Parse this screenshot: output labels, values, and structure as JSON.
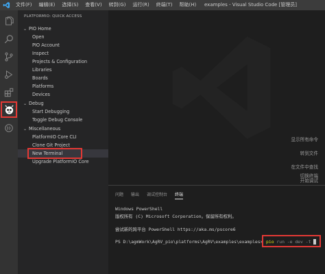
{
  "titlebar": {
    "menus": [
      "文件(F)",
      "编辑(E)",
      "选择(S)",
      "查看(V)",
      "转到(G)",
      "运行(R)",
      "终端(T)",
      "帮助(H)"
    ],
    "window_title": "examples - Visual Studio Code [管理员]"
  },
  "activity_bar": {
    "icons": [
      "explorer-icon",
      "search-icon",
      "source-control-icon",
      "run-debug-icon",
      "extensions-icon",
      "platformio-icon",
      "remote-icon"
    ],
    "highlighted": "platformio-icon",
    "highlight_color": "#e53935"
  },
  "sidebar": {
    "title": "PLATFORMIO: QUICK ACCESS",
    "groups": [
      {
        "label": "PIO Home",
        "items": [
          "Open",
          "PIO Account",
          "Inspect",
          "Projects & Configuration",
          "Libraries",
          "Boards",
          "Platforms",
          "Devices"
        ]
      },
      {
        "label": "Debug",
        "items": [
          "Start Debugging",
          "Toggle Debug Console"
        ]
      },
      {
        "label": "Miscellaneous",
        "items": [
          "PlatformIO Core CLI",
          "Clone Git Project",
          "New Terminal",
          "Upgrade PlatformIO Core"
        ]
      }
    ],
    "selected_item": "New Terminal"
  },
  "editor": {
    "shortcuts": [
      "显示所有命令",
      "转到文件",
      "在文件中查找",
      "开始调试",
      "切换终端"
    ]
  },
  "panel": {
    "tabs": [
      "问题",
      "输出",
      "调试控制台",
      "终端"
    ],
    "active_tab": "终端",
    "terminal": {
      "line1": "Windows PowerShell",
      "line2": "版权所有 (C) Microsoft Corporation。保留所有权利。",
      "line3": "尝试新的跨平台 PowerShell https://aka.ms/pscore6",
      "prompt": "PS D:\\agmWork\\AgRV_pio\\platforms\\AgRV\\examples\\examples>",
      "command": "pio",
      "args": "run -e dev -t"
    }
  }
}
